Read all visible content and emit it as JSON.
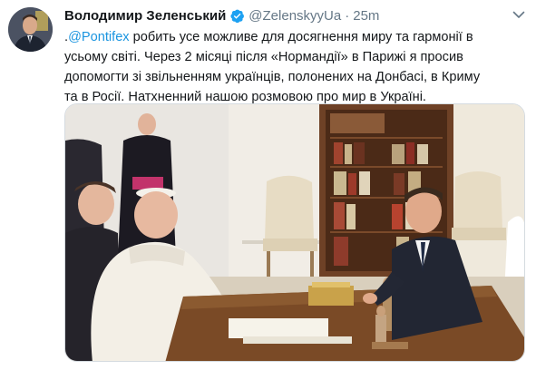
{
  "tweet": {
    "author_name": "Володимир Зеленський",
    "handle": "@ZelenskyyUa",
    "separator": "·",
    "time": "25m",
    "text_prefix": ".",
    "mention": "@Pontifex",
    "text": " робить усе можливе для досягнення миру та гармонії в усьому світі. Через 2 місяці після «Нормандії» в Парижі я просив допомогти зі звільненням українців, полонених на Донбасі, в Криму та в Росії. Натхненний нашою розмовою про мир в Україні."
  },
  "icons": {
    "verified": "verified-badge-icon",
    "menu": "chevron-down-icon"
  },
  "colors": {
    "link": "#1b95e0",
    "verified": "#1da1f2",
    "secondary_text": "#657786",
    "primary_text": "#14171a"
  }
}
